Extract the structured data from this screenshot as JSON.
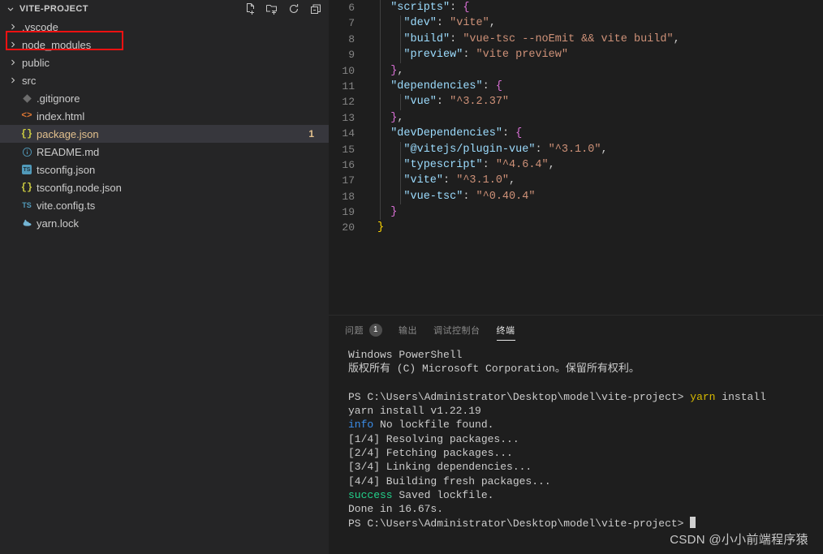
{
  "sidebar": {
    "title": "VITE-PROJECT",
    "chevron_icon": "chevron-down-icon",
    "actions": [
      {
        "name": "new-file-icon",
        "tooltip": "新建文件"
      },
      {
        "name": "new-folder-icon",
        "tooltip": "新建文件夹"
      },
      {
        "name": "refresh-icon",
        "tooltip": "刷新资源管理器"
      },
      {
        "name": "collapse-all-icon",
        "tooltip": "在资源管理器中折叠文件夹"
      }
    ],
    "tree": [
      {
        "label": ".vscode",
        "type": "folder",
        "icon": "chevron-right-icon",
        "selected": false,
        "badge": ""
      },
      {
        "label": "node_modules",
        "type": "folder",
        "icon": "chevron-right-icon",
        "selected": false,
        "badge": ""
      },
      {
        "label": "public",
        "type": "folder",
        "icon": "chevron-right-icon",
        "selected": false,
        "badge": ""
      },
      {
        "label": "src",
        "type": "folder",
        "icon": "chevron-right-icon",
        "selected": false,
        "badge": ""
      },
      {
        "label": ".gitignore",
        "type": "file",
        "icon": "git-icon",
        "selected": false,
        "badge": ""
      },
      {
        "label": "index.html",
        "type": "file",
        "icon": "html-icon",
        "selected": false,
        "badge": ""
      },
      {
        "label": "package.json",
        "type": "file",
        "icon": "json-icon",
        "selected": true,
        "badge": "1"
      },
      {
        "label": "README.md",
        "type": "file",
        "icon": "info-markdown-icon",
        "selected": false,
        "badge": ""
      },
      {
        "label": "tsconfig.json",
        "type": "file",
        "icon": "tsconfig-icon",
        "selected": false,
        "badge": ""
      },
      {
        "label": "tsconfig.node.json",
        "type": "file",
        "icon": "json-icon",
        "selected": false,
        "badge": ""
      },
      {
        "label": "vite.config.ts",
        "type": "file",
        "icon": "typescript-icon",
        "selected": false,
        "badge": ""
      },
      {
        "label": "yarn.lock",
        "type": "file",
        "icon": "yarn-icon",
        "selected": false,
        "badge": ""
      }
    ]
  },
  "editor": {
    "language": "json",
    "first_visible_line": 6,
    "lines": [
      {
        "n": "6",
        "tokens": [
          {
            "t": "  ",
            "c": "p"
          },
          {
            "t": "\"scripts\"",
            "c": "k"
          },
          {
            "t": ": ",
            "c": "p"
          },
          {
            "t": "{",
            "c": "b2"
          }
        ]
      },
      {
        "n": "7",
        "tokens": [
          {
            "t": "    ",
            "c": "p"
          },
          {
            "t": "\"dev\"",
            "c": "k"
          },
          {
            "t": ": ",
            "c": "p"
          },
          {
            "t": "\"vite\"",
            "c": "s"
          },
          {
            "t": ",",
            "c": "p"
          }
        ]
      },
      {
        "n": "8",
        "tokens": [
          {
            "t": "    ",
            "c": "p"
          },
          {
            "t": "\"build\"",
            "c": "k"
          },
          {
            "t": ": ",
            "c": "p"
          },
          {
            "t": "\"vue-tsc --noEmit && vite build\"",
            "c": "s"
          },
          {
            "t": ",",
            "c": "p"
          }
        ]
      },
      {
        "n": "9",
        "tokens": [
          {
            "t": "    ",
            "c": "p"
          },
          {
            "t": "\"preview\"",
            "c": "k"
          },
          {
            "t": ": ",
            "c": "p"
          },
          {
            "t": "\"vite preview\"",
            "c": "s"
          }
        ]
      },
      {
        "n": "10",
        "tokens": [
          {
            "t": "  ",
            "c": "p"
          },
          {
            "t": "}",
            "c": "b2"
          },
          {
            "t": ",",
            "c": "p"
          }
        ]
      },
      {
        "n": "11",
        "tokens": [
          {
            "t": "  ",
            "c": "p"
          },
          {
            "t": "\"dependencies\"",
            "c": "k"
          },
          {
            "t": ": ",
            "c": "p"
          },
          {
            "t": "{",
            "c": "b2"
          }
        ]
      },
      {
        "n": "12",
        "tokens": [
          {
            "t": "    ",
            "c": "p"
          },
          {
            "t": "\"vue\"",
            "c": "k"
          },
          {
            "t": ": ",
            "c": "p"
          },
          {
            "t": "\"^3.2.37\"",
            "c": "s"
          }
        ]
      },
      {
        "n": "13",
        "tokens": [
          {
            "t": "  ",
            "c": "p"
          },
          {
            "t": "}",
            "c": "b2"
          },
          {
            "t": ",",
            "c": "p"
          }
        ]
      },
      {
        "n": "14",
        "tokens": [
          {
            "t": "  ",
            "c": "p"
          },
          {
            "t": "\"devDependencies\"",
            "c": "k"
          },
          {
            "t": ": ",
            "c": "p"
          },
          {
            "t": "{",
            "c": "b2"
          }
        ]
      },
      {
        "n": "15",
        "tokens": [
          {
            "t": "    ",
            "c": "p"
          },
          {
            "t": "\"@vitejs/plugin-vue\"",
            "c": "k"
          },
          {
            "t": ": ",
            "c": "p"
          },
          {
            "t": "\"^3.1.0\"",
            "c": "s"
          },
          {
            "t": ",",
            "c": "p"
          }
        ]
      },
      {
        "n": "16",
        "tokens": [
          {
            "t": "    ",
            "c": "p"
          },
          {
            "t": "\"typescript\"",
            "c": "k"
          },
          {
            "t": ": ",
            "c": "p"
          },
          {
            "t": "\"^4.6.4\"",
            "c": "s"
          },
          {
            "t": ",",
            "c": "p"
          }
        ]
      },
      {
        "n": "17",
        "tokens": [
          {
            "t": "    ",
            "c": "p"
          },
          {
            "t": "\"vite\"",
            "c": "k"
          },
          {
            "t": ": ",
            "c": "p"
          },
          {
            "t": "\"^3.1.0\"",
            "c": "s"
          },
          {
            "t": ",",
            "c": "p"
          }
        ]
      },
      {
        "n": "18",
        "tokens": [
          {
            "t": "    ",
            "c": "p"
          },
          {
            "t": "\"vue-tsc\"",
            "c": "k"
          },
          {
            "t": ": ",
            "c": "p"
          },
          {
            "t": "\"^0.40.4\"",
            "c": "s"
          }
        ]
      },
      {
        "n": "19",
        "tokens": [
          {
            "t": "  ",
            "c": "p"
          },
          {
            "t": "}",
            "c": "b2"
          }
        ]
      },
      {
        "n": "20",
        "tokens": [
          {
            "t": "",
            "c": "p"
          },
          {
            "t": "}",
            "c": "b1"
          }
        ]
      }
    ]
  },
  "panel": {
    "tabs": [
      {
        "label": "问题",
        "badge": "1",
        "active": false
      },
      {
        "label": "输出",
        "badge": "",
        "active": false
      },
      {
        "label": "调试控制台",
        "badge": "",
        "active": false
      },
      {
        "label": "终端",
        "badge": "",
        "active": true
      }
    ],
    "terminal_lines": [
      {
        "segments": [
          {
            "t": "Windows PowerShell",
            "c": ""
          }
        ]
      },
      {
        "segments": [
          {
            "t": "版权所有 (C) Microsoft Corporation。保留所有权利。",
            "c": ""
          }
        ]
      },
      {
        "segments": [
          {
            "t": "",
            "c": ""
          }
        ]
      },
      {
        "segments": [
          {
            "t": "PS C:\\Users\\Administrator\\Desktop\\model\\vite-project> ",
            "c": ""
          },
          {
            "t": "yarn",
            "c": "t-yellow"
          },
          {
            "t": " install",
            "c": ""
          }
        ]
      },
      {
        "segments": [
          {
            "t": "yarn install v1.22.19",
            "c": ""
          }
        ]
      },
      {
        "segments": [
          {
            "t": "info",
            "c": "t-info"
          },
          {
            "t": " No lockfile found.",
            "c": ""
          }
        ]
      },
      {
        "segments": [
          {
            "t": "[1/4] Resolving packages...",
            "c": ""
          }
        ]
      },
      {
        "segments": [
          {
            "t": "[2/4] Fetching packages...",
            "c": ""
          }
        ]
      },
      {
        "segments": [
          {
            "t": "[3/4] Linking dependencies...",
            "c": ""
          }
        ]
      },
      {
        "segments": [
          {
            "t": "[4/4] Building fresh packages...",
            "c": ""
          }
        ]
      },
      {
        "segments": [
          {
            "t": "success",
            "c": "t-success"
          },
          {
            "t": " Saved lockfile.",
            "c": ""
          }
        ]
      },
      {
        "segments": [
          {
            "t": "Done in 16.67s.",
            "c": ""
          }
        ]
      },
      {
        "segments": [
          {
            "t": "PS C:\\Users\\Administrator\\Desktop\\model\\vite-project> ",
            "c": ""
          },
          {
            "t": "CURSOR",
            "c": "cursor"
          }
        ]
      }
    ]
  },
  "annotations": [
    {
      "name": "node-modules-highlight",
      "color": "#ee1111",
      "target": "node_modules"
    },
    {
      "name": "yarn-install-highlight",
      "color": "#ee1111",
      "target": "yarn install"
    }
  ],
  "watermark": {
    "text": "CSDN @小小前端程序猿"
  }
}
